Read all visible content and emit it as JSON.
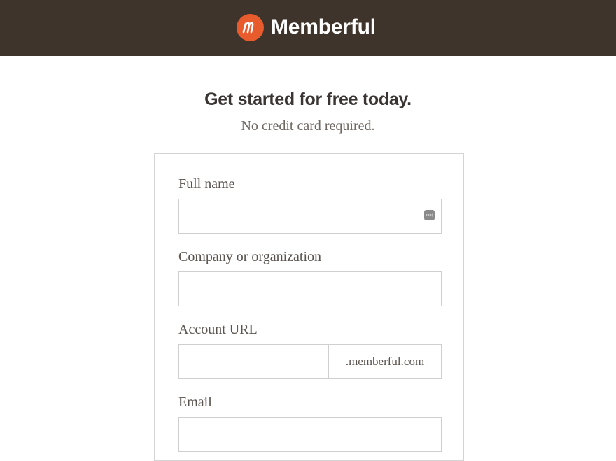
{
  "header": {
    "brand_name": "Memberful",
    "logo_letter": "m",
    "background_color": "#3f342b",
    "logo_color": "#e85b2c"
  },
  "hero": {
    "title": "Get started for free today.",
    "subtitle": "No credit card required."
  },
  "form": {
    "full_name": {
      "label": "Full name",
      "value": "",
      "placeholder": ""
    },
    "company": {
      "label": "Company or organization",
      "value": "",
      "placeholder": ""
    },
    "account_url": {
      "label": "Account URL",
      "value": "",
      "placeholder": "",
      "suffix": ".memberful.com"
    },
    "email": {
      "label": "Email",
      "value": "",
      "placeholder": ""
    }
  },
  "icons": {
    "autofill": "autofill-icon"
  }
}
